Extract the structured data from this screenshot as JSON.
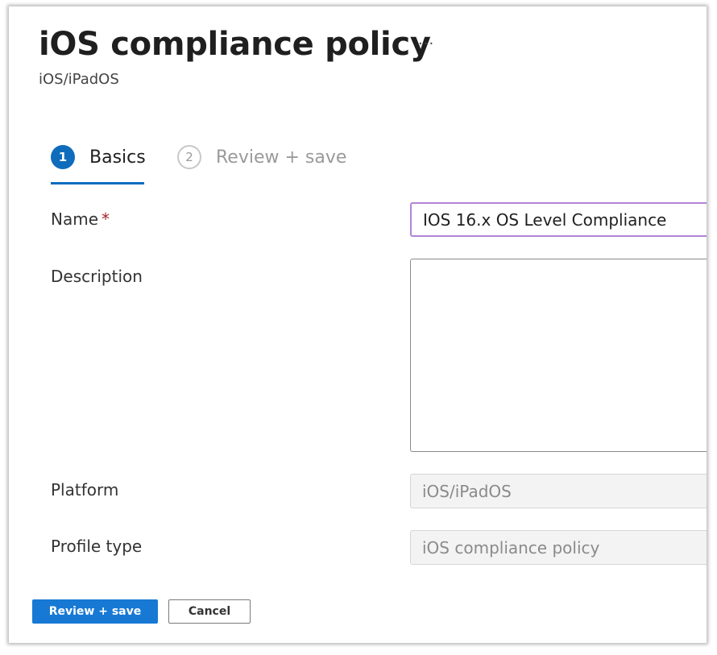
{
  "header": {
    "title": "iOS compliance policy",
    "more_glyph": "···",
    "subtitle": "iOS/iPadOS"
  },
  "steps": [
    {
      "number": "1",
      "label": "Basics",
      "active": true
    },
    {
      "number": "2",
      "label": "Review + save",
      "active": false
    }
  ],
  "form": {
    "name": {
      "label": "Name",
      "required_marker": "*",
      "value": "IOS 16.x OS Level Compliance"
    },
    "description": {
      "label": "Description",
      "value": ""
    },
    "platform": {
      "label": "Platform",
      "value": "iOS/iPadOS"
    },
    "profile_type": {
      "label": "Profile type",
      "value": "iOS compliance policy"
    }
  },
  "footer": {
    "review_save_label": "Review + save",
    "cancel_label": "Cancel"
  },
  "colors": {
    "accent": "#0f6cbd",
    "primary_button": "#1779d4",
    "required": "#a4262c",
    "focus_border": "#b185d6"
  }
}
